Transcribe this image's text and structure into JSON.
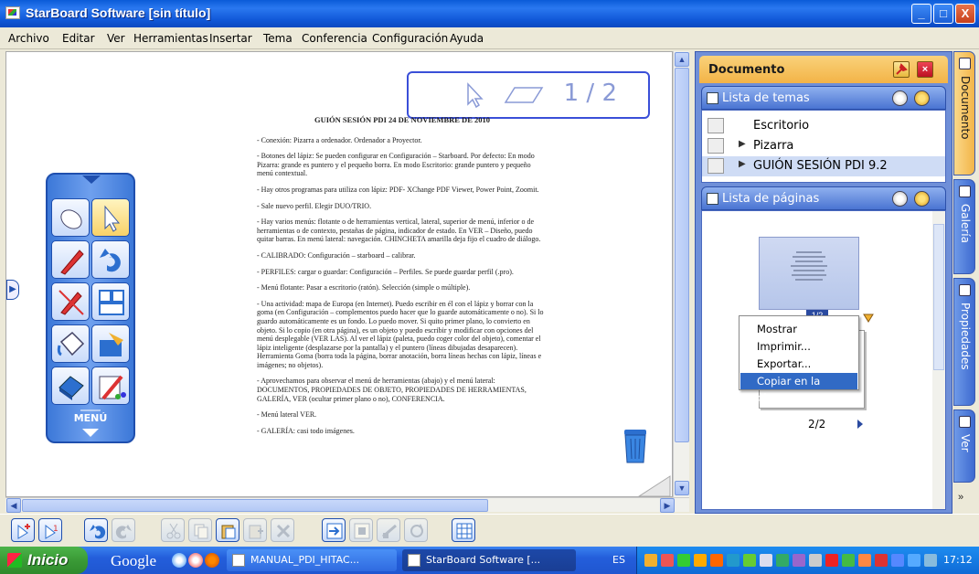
{
  "window": {
    "title": "StarBoard Software [sin título]",
    "controls": {
      "minimize": "_",
      "maximize": "□",
      "close": "X"
    }
  },
  "menubar": {
    "items": [
      "Archivo",
      "Editar",
      "Ver",
      "Herramientas",
      "Insertar",
      "Tema",
      "Conferencia",
      "Configuración",
      "Ayuda"
    ]
  },
  "canvas": {
    "page_counter": "1 / 2",
    "document": {
      "title": "GUIÓN SESIÓN PDI 24 DE NOVIEMBRE DE 2010",
      "paragraphs": [
        "- Conexión: Pizarra a ordenador. Ordenador a Proyector.",
        "- Botones del lápiz: Se pueden configurar en Configuración – Starboard. Por defecto: En modo Pizarra: grande es puntero y el pequeño borra. En modo Escritorio: grande puntero y pequeño menú contextual.",
        "- Hay otros programas para utiliza con lápiz: PDF- XChange PDF Viewer, Power Point, Zoomit.",
        "- Sale nuevo perfil. Elegir DUO/TRIO.",
        "- Hay varios menús: flotante o de herramientas vertical, lateral, superior de menú, inferior o de herramientas o de contexto, pestañas de página, indicador de estado. En VER – Diseño, puedo quitar barras. En menú lateral: navegación. CHINCHETA amarilla deja fijo el cuadro de diálogo.",
        "- CALIBRADO: Configuración – starboard – calibrar.",
        "- PERFILES: cargar o guardar: Configuración – Perfiles. Se puede guardar perfil (.pro).",
        "- Menú flotante: Pasar a escritorio (ratón). Selección (simple o múltiple).",
        "- Una actividad: mapa de Europa (en Internet). Puedo escribir en él con el lápiz y borrar con la goma (en Configuración – complementos puedo hacer que lo guarde automáticamente o no). Si lo guardo automáticamente es un fondo. Lo puedo mover. Si quito primer plano, lo convierto en objeto. Si lo copio (en otra página), es un objeto y puedo escribir y modificar con opciones del menú desplegable (VER LAS). Al ver el lápiz (paleta, puedo coger color del objeto), comentar el lápiz inteligente (desplazarse por la pantalla) y el puntero (líneas dibujadas desaparecen). Herramienta Goma (borra toda la página, borrar anotación, borra líneas hechas con lápiz, líneas e imágenes; no objetos).",
        "- Aprovechamos para observar el menú de herramientas (abajo) y el menú lateral: DOCUMENTOS, PROPIEDADES DE OBJETO, PROPIEDADES DE HERRAMIENTAS, GALERÍA, VER (ocultar primer plano o no), CONFERENCIA.",
        "- Menú lateral VER.",
        "- GALERÍA: casi todo imágenes."
      ]
    }
  },
  "floating_menu": {
    "label": "MENÚ",
    "tools": [
      "mouse-tool",
      "pointer-tool",
      "pen-tool",
      "undo-tool",
      "pen-settings-tool",
      "page-layout-tool",
      "paint-bucket-tool",
      "toolbox-tool",
      "eraser-tool",
      "color-palette-tool"
    ]
  },
  "right_panel": {
    "title": "Documento",
    "topics_section": {
      "title": "Lista de temas",
      "items": [
        {
          "label": "Escritorio",
          "expandable": false,
          "selected": false
        },
        {
          "label": "Pizarra",
          "expandable": true,
          "selected": false
        },
        {
          "label": "GUIÓN SESIÓN PDI 9.2",
          "expandable": true,
          "selected": true
        }
      ]
    },
    "pages_section": {
      "title": "Lista de páginas",
      "page1_badge": "1/2",
      "page2_label": "2/2"
    }
  },
  "context_menu": {
    "items": [
      {
        "label": "Mostrar",
        "highlighted": false
      },
      {
        "label": "Imprimir...",
        "highlighted": false
      },
      {
        "label": "Exportar...",
        "highlighted": false
      },
      {
        "label": "Copiar en la pizarra",
        "highlighted": true
      }
    ]
  },
  "side_tabs": [
    "Documento",
    "Galería",
    "Propiedades",
    "Ver"
  ],
  "side_more": "»",
  "bottom_toolbar": {
    "buttons": [
      "new-page",
      "new-page-numbered",
      "undo",
      "redo",
      "cut",
      "copy",
      "paste",
      "paste-special",
      "delete",
      "import",
      "export",
      "print-screen",
      "rotate",
      "grid"
    ]
  },
  "taskbar": {
    "start_label": "Inicio",
    "search_label": "Google",
    "tasks": [
      {
        "label": "MANUAL_PDI_HITAC...",
        "active": false
      },
      {
        "label": "StarBoard Software [...",
        "active": true
      }
    ],
    "language": "ES",
    "clock": "17:12"
  },
  "colors": {
    "titlebar": "#0a5bd8",
    "panel_accent": "#f3b347",
    "tool_active": "#f8d268",
    "selection": "#316ac5",
    "taskbar": "#245edb"
  }
}
